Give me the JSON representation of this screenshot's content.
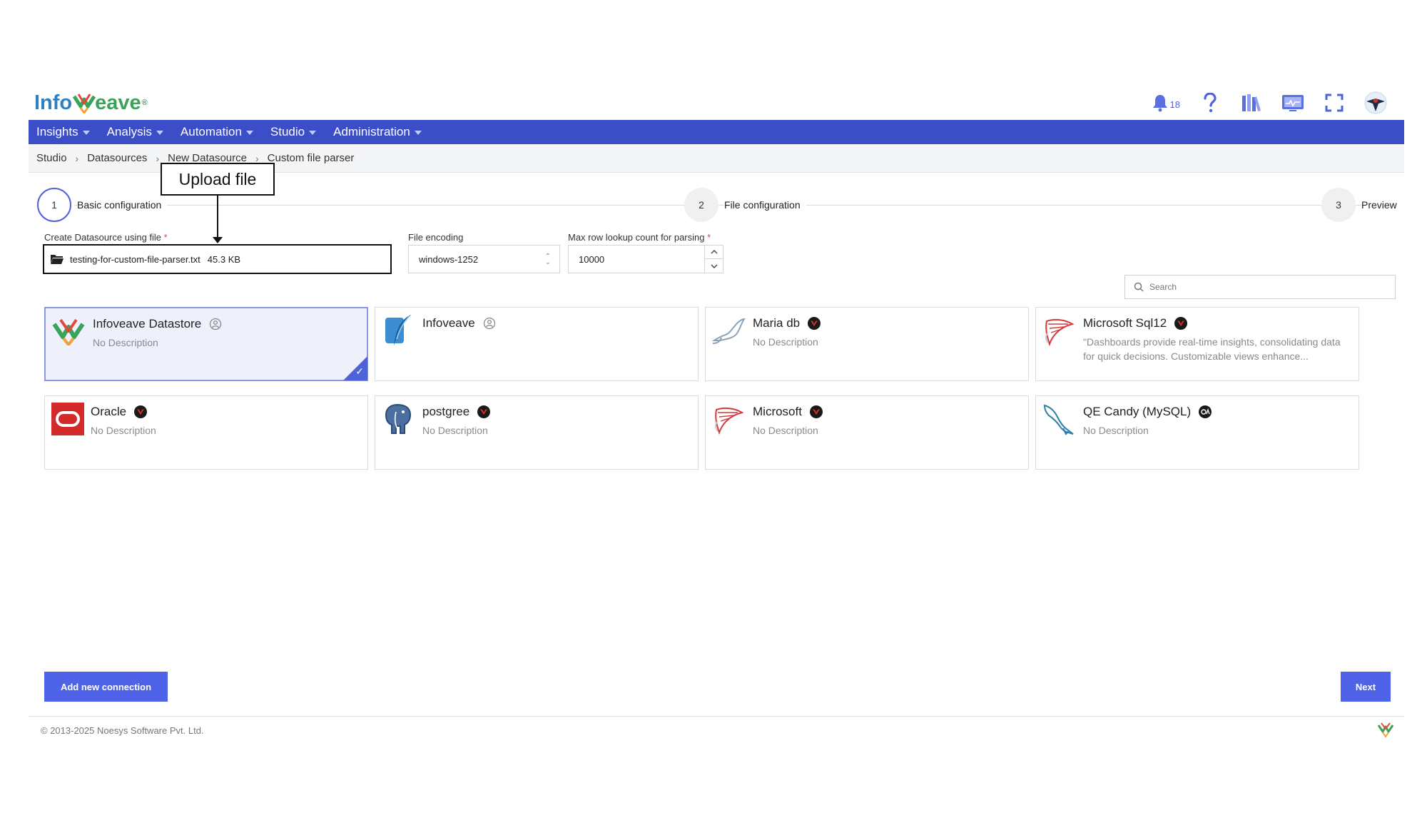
{
  "header": {
    "logo_text_left": "Info",
    "logo_text_right": "eave",
    "logo_reg": "®",
    "notification_count": "18",
    "icons": [
      "bell-icon",
      "help-icon",
      "library-icon",
      "monitor-icon",
      "fullscreen-icon",
      "avatar"
    ]
  },
  "nav": {
    "items": [
      {
        "label": "Insights"
      },
      {
        "label": "Analysis"
      },
      {
        "label": "Automation"
      },
      {
        "label": "Studio"
      },
      {
        "label": "Administration"
      }
    ]
  },
  "breadcrumb": {
    "items": [
      "Studio",
      "Datasources",
      "New Datasource",
      "Custom file parser"
    ]
  },
  "stepper": {
    "steps": [
      {
        "number": "1",
        "label": "Basic configuration"
      },
      {
        "number": "2",
        "label": "File configuration"
      },
      {
        "number": "3",
        "label": "Preview"
      }
    ]
  },
  "annotation": {
    "label": "Upload file"
  },
  "form": {
    "file_label": "Create Datasource using file",
    "required_mark": "*",
    "file_name": "testing-for-custom-file-parser.txt",
    "file_size": "45.3 KB",
    "encoding_label": "File encoding",
    "encoding_value": "windows-1252",
    "max_row_label": "Max row lookup count for parsing",
    "max_row_value": "10000",
    "search_placeholder": "Search"
  },
  "cards": [
    {
      "title": "Infoveave Datastore",
      "description": "No Description",
      "selected": true
    },
    {
      "title": "Infoveave",
      "description": ""
    },
    {
      "title": "Maria db",
      "description": "No Description"
    },
    {
      "title": "Microsoft Sql12",
      "description": "\"Dashboards provide real-time insights, consolidating data for quick decisions. Customizable views enhance..."
    },
    {
      "title": "Oracle",
      "description": "No Description"
    },
    {
      "title": "postgree",
      "description": "No Description"
    },
    {
      "title": "Microsoft",
      "description": "No Description"
    },
    {
      "title": "QE Candy (MySQL)",
      "description": "No Description"
    }
  ],
  "buttons": {
    "add_connection": "Add new connection",
    "next": "Next"
  },
  "footer": {
    "copyright": "© 2013-2025 Noesys Software Pvt. Ltd."
  },
  "colors": {
    "nav_bg": "#3b4ec8",
    "accent": "#4f63e8",
    "logo_blue": "#2f7fc1",
    "logo_green": "#3aa35a"
  }
}
